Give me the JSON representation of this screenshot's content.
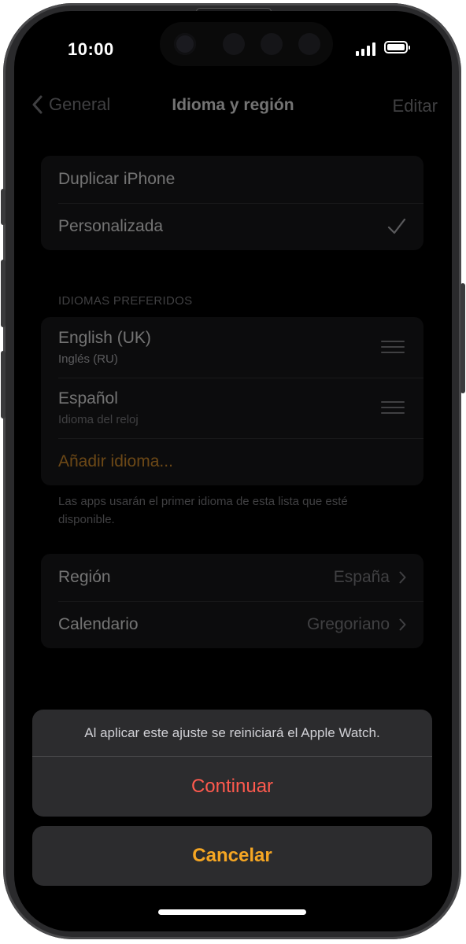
{
  "status_bar": {
    "time": "10:00"
  },
  "nav": {
    "back_label": "General",
    "title": "Idioma y región",
    "edit_label": "Editar"
  },
  "mode_group": {
    "items": [
      {
        "label": "Duplicar iPhone"
      },
      {
        "label": "Personalizada",
        "selected": true
      }
    ]
  },
  "languages": {
    "header": "IDIOMAS PREFERIDOS",
    "items": [
      {
        "label": "English (UK)",
        "sublabel": "Inglés (RU)"
      },
      {
        "label": "Español",
        "sublabel": "Idioma del reloj"
      }
    ],
    "add_label": "Añadir idioma...",
    "footnote": "Las apps usarán el primer idioma de esta lista que esté disponible."
  },
  "region_group": {
    "items": [
      {
        "label": "Región",
        "value": "España"
      },
      {
        "label": "Calendario",
        "value": "Gregoriano"
      }
    ]
  },
  "action_sheet": {
    "message": "Al aplicar este ajuste se reiniciará el Apple Watch.",
    "continue_label": "Continuar",
    "cancel_label": "Cancelar"
  },
  "colors": {
    "accent": "#f0a032",
    "destructive": "#ff5a4e",
    "cancel": "#f5a623"
  }
}
